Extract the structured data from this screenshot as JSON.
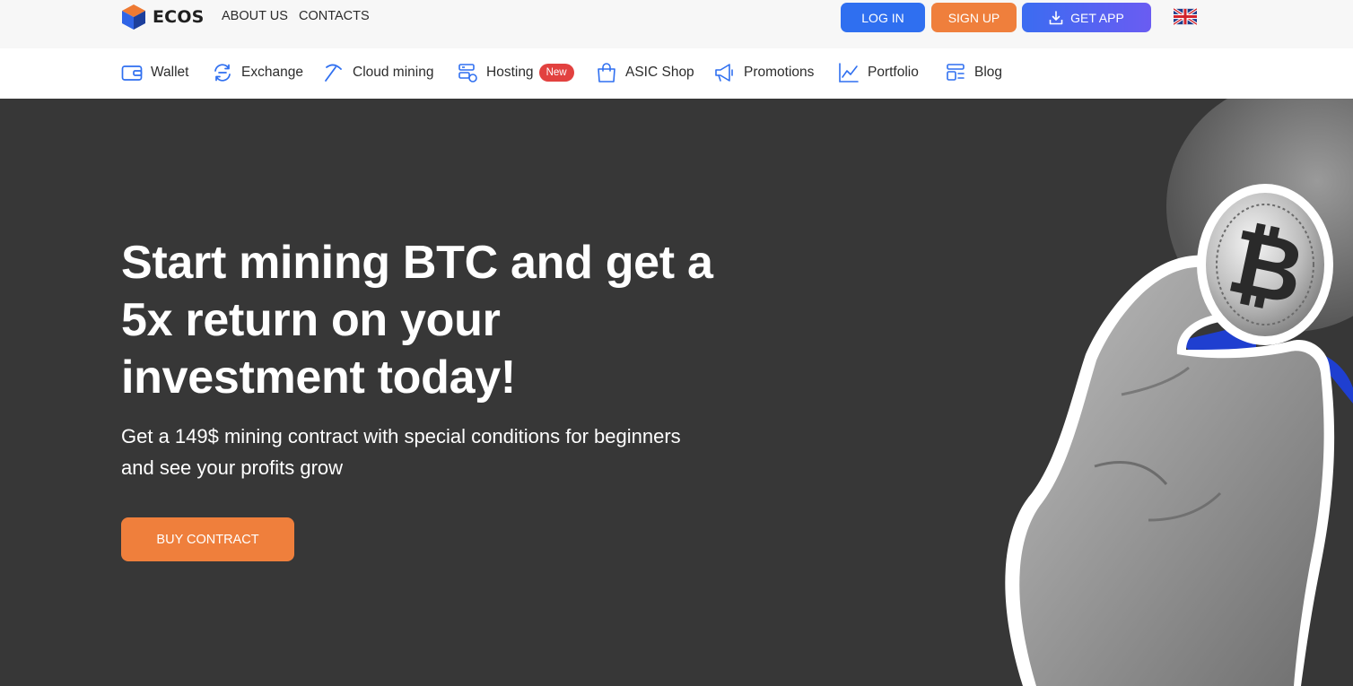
{
  "brand": {
    "name": "ECOS",
    "colors": {
      "blue": "#2f6ff0",
      "orange": "#ef7f3c",
      "red": "#e2413f",
      "dark": "#373737"
    }
  },
  "topbar": {
    "links": [
      "ABOUT US",
      "CONTACTS"
    ],
    "login_label": "LOG IN",
    "signup_label": "SIGN UP",
    "getapp_label": "GET APP",
    "language_flag": "uk-flag-icon"
  },
  "nav": {
    "items": [
      {
        "label": "Wallet",
        "icon": "wallet-icon"
      },
      {
        "label": "Exchange",
        "icon": "exchange-icon"
      },
      {
        "label": "Cloud mining",
        "icon": "pickaxe-icon"
      },
      {
        "label": "Hosting",
        "icon": "server-icon",
        "badge": "New"
      },
      {
        "label": "ASIC Shop",
        "icon": "shopping-bag-icon"
      },
      {
        "label": "Promotions",
        "icon": "megaphone-icon"
      },
      {
        "label": "Portfolio",
        "icon": "chart-line-icon"
      },
      {
        "label": "Blog",
        "icon": "blog-icon"
      }
    ]
  },
  "hero": {
    "title": "Start mining BTC and get a 5x return on your investment today!",
    "subtitle": "Get a 149$ mining contract with special conditions for beginners and see your profits grow",
    "cta_label": "BUY CONTRACT",
    "image": "hand-holding-bitcoin-image"
  }
}
